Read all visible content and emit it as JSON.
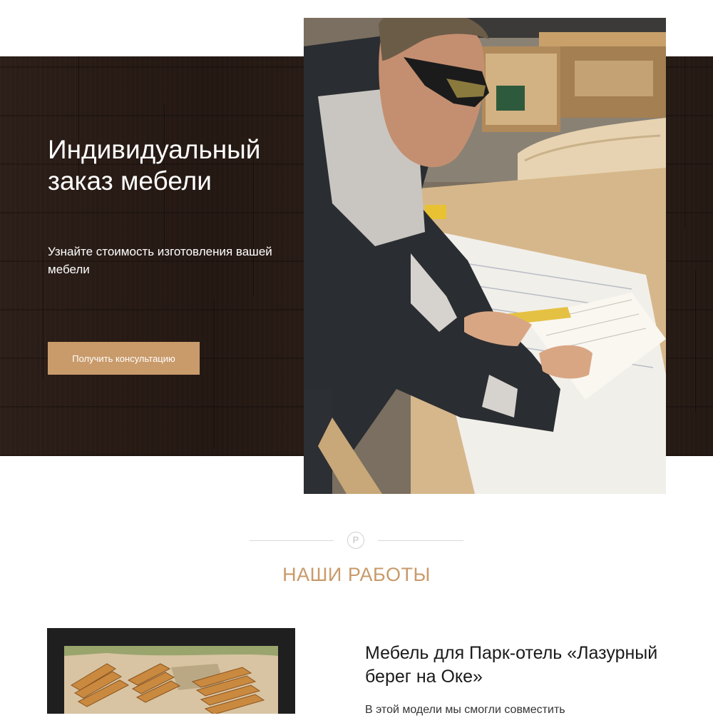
{
  "hero": {
    "title": "Индивидуальный заказ мебели",
    "subtitle": "Узнайте стоимость изготовления вашей мебели",
    "cta_label": "Получить консультацию"
  },
  "section": {
    "title": "НАШИ РАБОТЫ",
    "logo_glyph": "P"
  },
  "work": {
    "title": "Мебель для Парк-отель «Лазурный берег на Оке»",
    "description": "В этой модели мы смогли совместить"
  },
  "colors": {
    "accent": "#c99a6a",
    "hero_bg": "#2a1c17",
    "text_dark": "#1a1a1a"
  }
}
